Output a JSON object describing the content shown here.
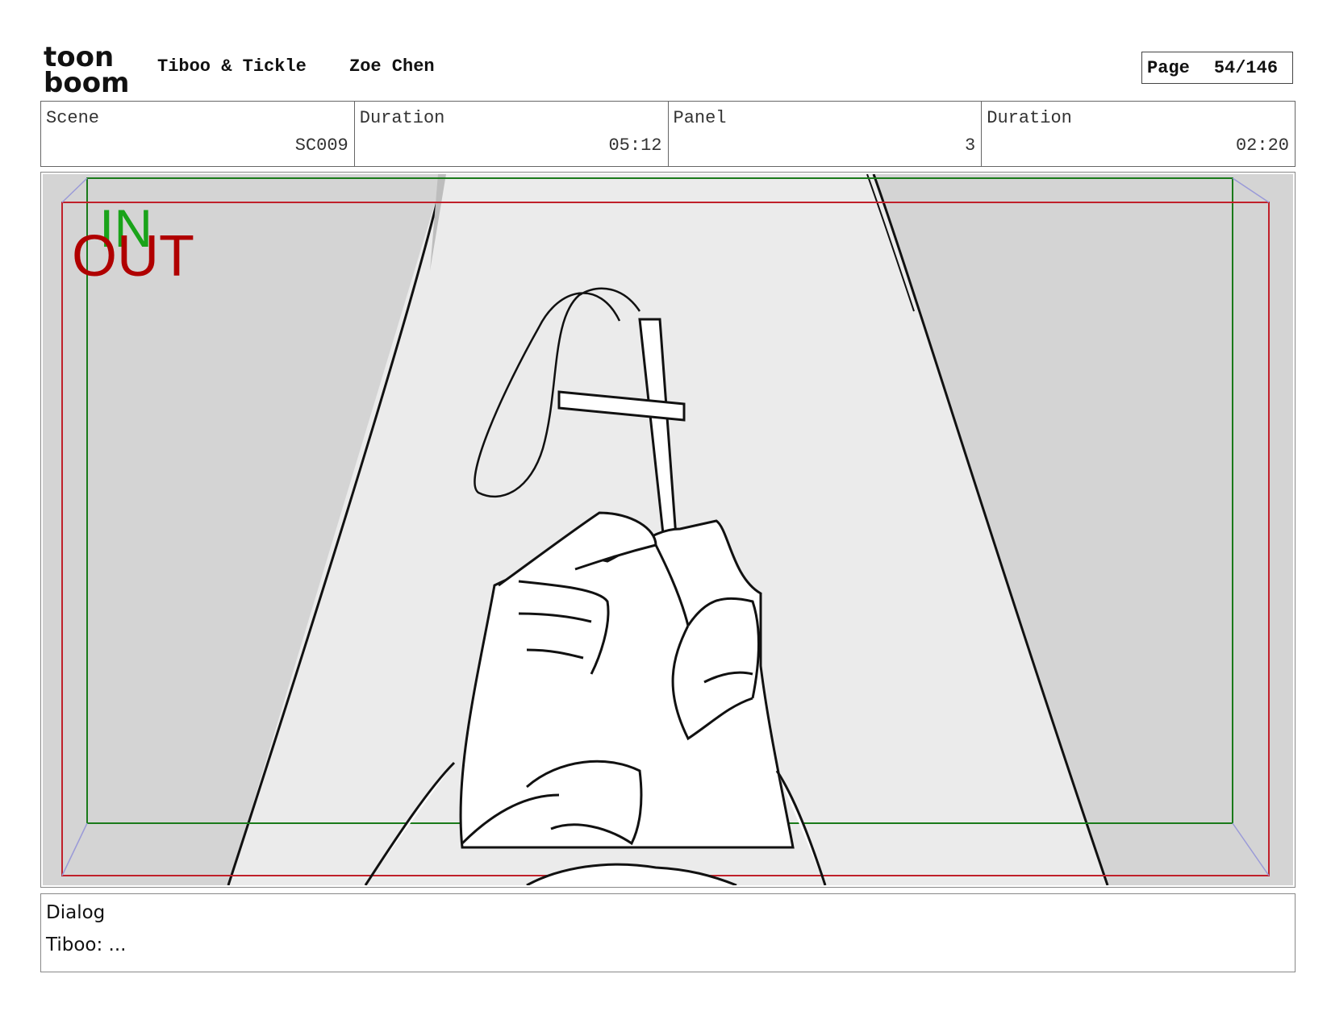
{
  "header": {
    "logo_text_top": "toon",
    "logo_text_bottom": "boom",
    "project": "Tiboo & Tickle",
    "author": "Zoe Chen",
    "page_label": "Page",
    "page_value": "54/146"
  },
  "info": {
    "scene_label": "Scene",
    "scene_value": "SC009",
    "scene_duration_label": "Duration",
    "scene_duration_value": "05:12",
    "panel_label": "Panel",
    "panel_value": "3",
    "panel_duration_label": "Duration",
    "panel_duration_value": "02:20"
  },
  "panel": {
    "in_label": "IN",
    "out_label": "OUT",
    "in_color": "#1aa31a",
    "out_color": "#b00000",
    "description": "Sketch of two hands holding up a cross on a string in a spotlight between curtains"
  },
  "dialog": {
    "label": "Dialog",
    "text": "Tiboo: ..."
  }
}
